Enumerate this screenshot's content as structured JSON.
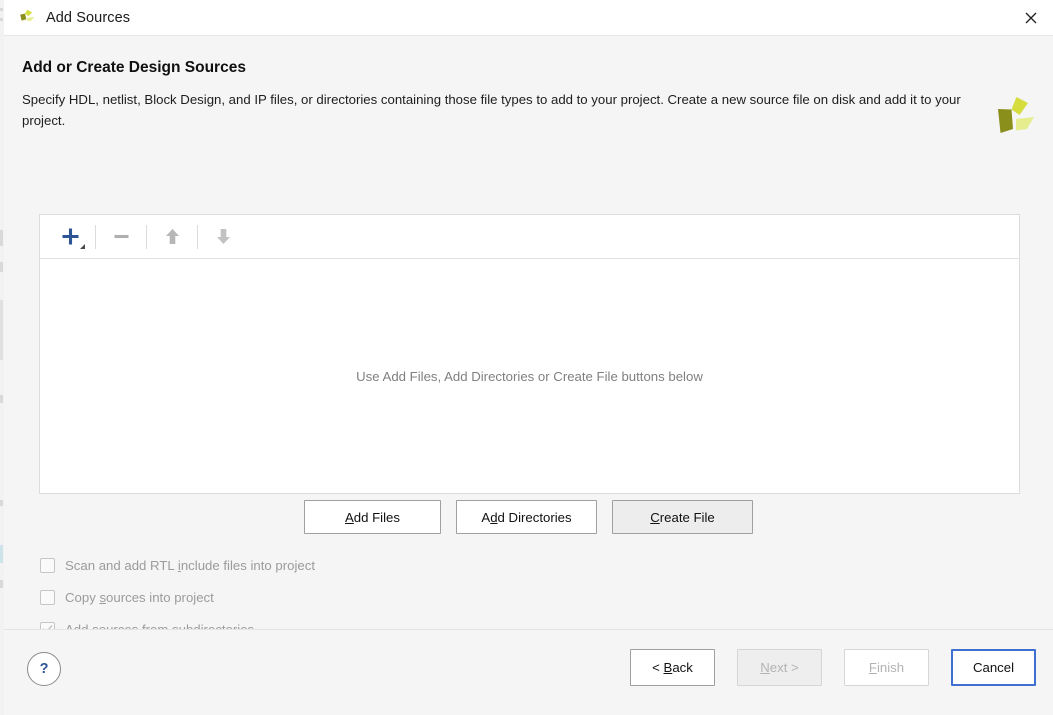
{
  "window": {
    "title": "Add Sources",
    "app_icon": "vivado-pinwheel-icon",
    "close_icon": "close-icon"
  },
  "header": {
    "title": "Add or Create Design Sources",
    "description": "Specify HDL, netlist, Block Design, and IP files, or directories containing those file types to add to your project. Create a new source file on disk and add it to your project.",
    "brand_logo": "xilinx-pinwheel-logo"
  },
  "source_panel": {
    "toolbar": [
      {
        "name": "add-button",
        "glyph": "+",
        "state": "enabled",
        "color": "#2d5596",
        "has_dropdown": true
      },
      {
        "name": "remove-button",
        "glyph": "−",
        "state": "disabled",
        "color": "#b0b0b0",
        "has_dropdown": false
      },
      {
        "name": "move-up-button",
        "glyph": "↑",
        "state": "disabled",
        "color": "#b0b0b0",
        "has_dropdown": false
      },
      {
        "name": "move-down-button",
        "glyph": "↓",
        "state": "disabled",
        "color": "#b0b0b0",
        "has_dropdown": false
      }
    ],
    "empty_hint": "Use Add Files, Add Directories or Create File buttons below"
  },
  "actions": [
    {
      "name": "add-files-button",
      "pre": "",
      "mnemonic": "A",
      "post": "dd Files",
      "state": "enabled"
    },
    {
      "name": "add-directories-button",
      "pre": "A",
      "mnemonic": "d",
      "post": "d Directories",
      "state": "enabled"
    },
    {
      "name": "create-file-button",
      "pre": "",
      "mnemonic": "C",
      "post": "reate File",
      "state": "hovered"
    }
  ],
  "options": [
    {
      "name": "scan-rtl-include-checkbox",
      "pre": "Scan and add RTL ",
      "mnemonic": "i",
      "post": "nclude files into project",
      "checked": false,
      "enabled": false
    },
    {
      "name": "copy-sources-checkbox",
      "pre": "Copy ",
      "mnemonic": "s",
      "post": "ources into project",
      "checked": false,
      "enabled": false
    },
    {
      "name": "add-subdirectories-checkbox",
      "pre": "Add so",
      "mnemonic": "u",
      "post": "rces from subdirectories",
      "checked": true,
      "enabled": false
    }
  ],
  "footer": {
    "help_label": "?",
    "nav": [
      {
        "name": "back-button",
        "pre": "< ",
        "mnemonic": "B",
        "post": "ack",
        "state": "enabled"
      },
      {
        "name": "next-button",
        "pre": "",
        "mnemonic": "N",
        "post": "ext >",
        "state": "disabled-shaded"
      },
      {
        "name": "finish-button",
        "pre": "",
        "mnemonic": "F",
        "post": "inish",
        "state": "disabled"
      },
      {
        "name": "cancel-button",
        "pre": "",
        "mnemonic": "",
        "post": "Cancel",
        "state": "focused"
      }
    ]
  },
  "colors": {
    "accent_blue": "#2d5596",
    "focus_blue": "#3f6fd1",
    "brand_olive": "#8a8f1b",
    "brand_yellow": "#d5dd3f",
    "brand_light": "#e6ed8f",
    "body_bg": "#f5f5f5"
  }
}
